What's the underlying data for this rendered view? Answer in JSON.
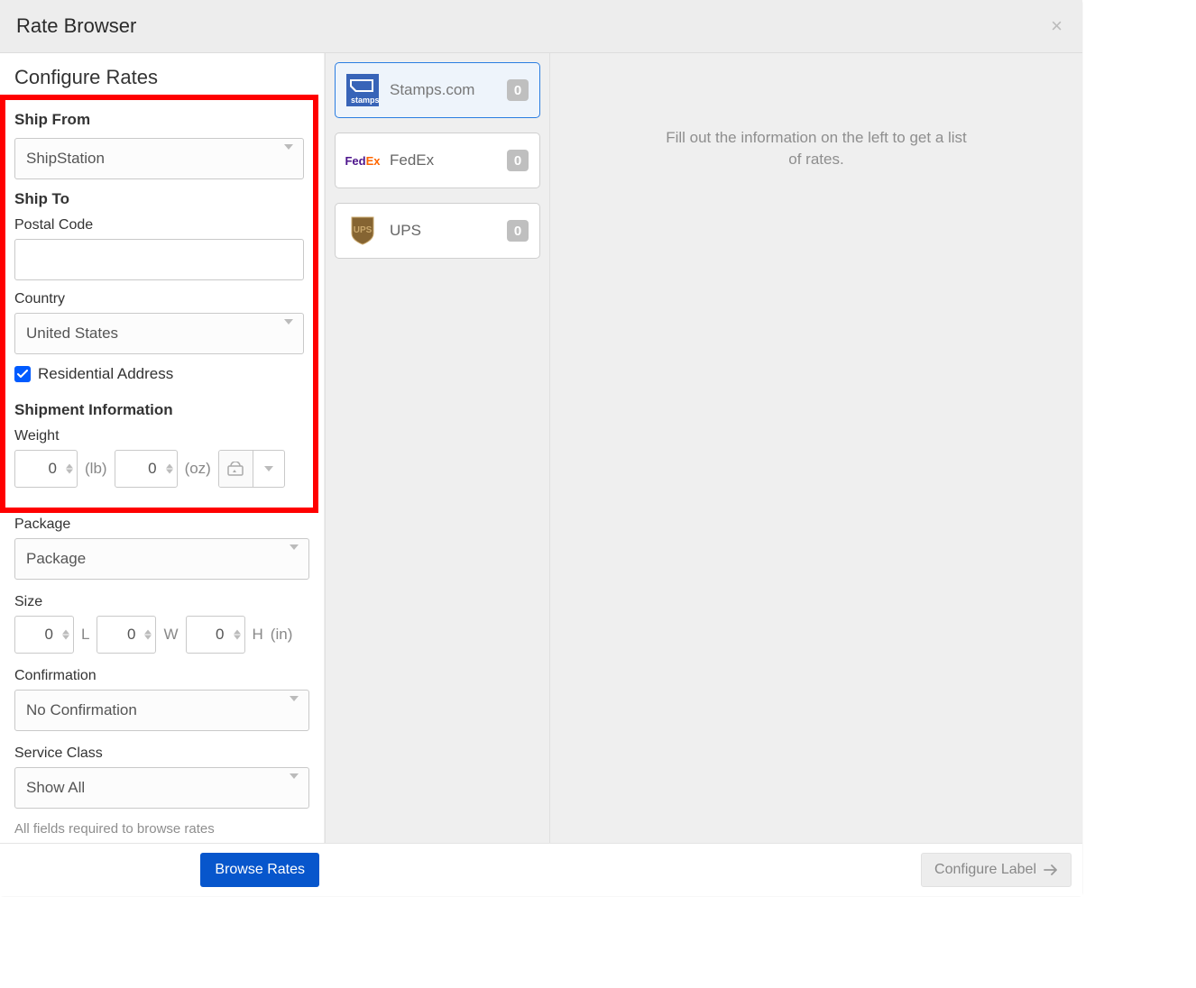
{
  "header": {
    "title": "Rate Browser"
  },
  "configure": {
    "title": "Configure Rates",
    "ship_from": {
      "label": "Ship From",
      "value": "ShipStation"
    },
    "ship_to": {
      "label": "Ship To",
      "postal_code_label": "Postal Code",
      "postal_code_value": "",
      "country_label": "Country",
      "country_value": "United States",
      "residential_label": "Residential Address",
      "residential_checked": true
    },
    "shipment": {
      "label": "Shipment Information",
      "weight_label": "Weight",
      "weight_lb": "0",
      "weight_oz": "0",
      "unit_lb": "(lb)",
      "unit_oz": "(oz)"
    },
    "package": {
      "label": "Package",
      "value": "Package"
    },
    "size": {
      "label": "Size",
      "l": "0",
      "l_label": "L",
      "w": "0",
      "w_label": "W",
      "h": "0",
      "h_label": "H",
      "unit": "(in)"
    },
    "confirmation": {
      "label": "Confirmation",
      "value": "No Confirmation"
    },
    "service_class": {
      "label": "Service Class",
      "value": "Show All"
    },
    "note": "All fields required to browse rates"
  },
  "carriers": [
    {
      "name": "Stamps.com",
      "count": "0",
      "active": true
    },
    {
      "name": "FedEx",
      "count": "0",
      "active": false
    },
    {
      "name": "UPS",
      "count": "0",
      "active": false
    }
  ],
  "hint": "Fill out the information on the left to get a list of rates.",
  "footer": {
    "browse": "Browse Rates",
    "configure_label": "Configure Label"
  }
}
